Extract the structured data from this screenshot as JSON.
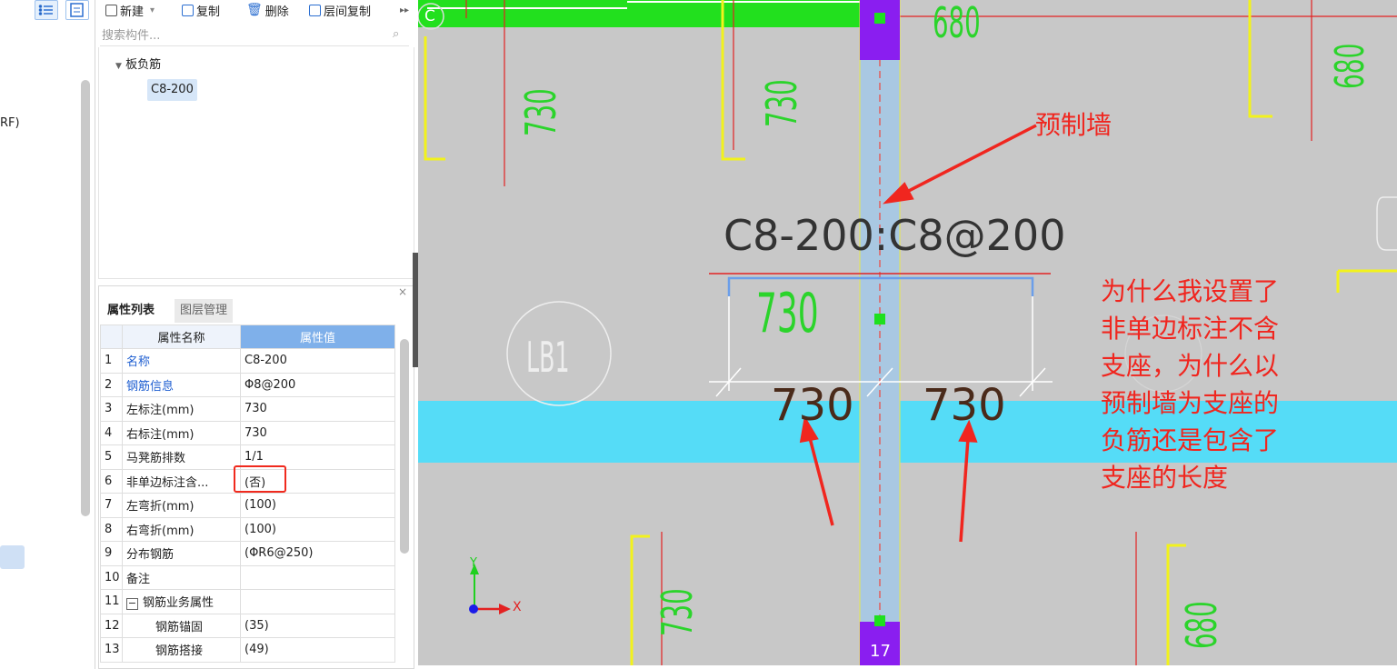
{
  "left_strip": {
    "partial_text": "RF)"
  },
  "toolbar": {
    "new_label": "新建",
    "copy_label": "复制",
    "delete_label": "删除",
    "floor_copy_label": "层间复制"
  },
  "search": {
    "placeholder": "搜索构件..."
  },
  "tree": {
    "category": "板负筋",
    "item": "C8-200"
  },
  "props": {
    "tabs": [
      "属性列表",
      "图层管理"
    ],
    "header": {
      "name": "属性名称",
      "value": "属性值"
    },
    "rows": [
      {
        "no": "1",
        "name": "名称",
        "value": "C8-200",
        "link": true
      },
      {
        "no": "2",
        "name": "钢筋信息",
        "value": "Φ8@200",
        "link": true
      },
      {
        "no": "3",
        "name": "左标注(mm)",
        "value": "730"
      },
      {
        "no": "4",
        "name": "右标注(mm)",
        "value": "730"
      },
      {
        "no": "5",
        "name": "马凳筋排数",
        "value": "1/1"
      },
      {
        "no": "6",
        "name": "非单边标注含...",
        "value": "(否)"
      },
      {
        "no": "7",
        "name": "左弯折(mm)",
        "value": "(100)"
      },
      {
        "no": "8",
        "name": "右弯折(mm)",
        "value": "(100)"
      },
      {
        "no": "9",
        "name": "分布钢筋",
        "value": "(ΦR6@250)"
      },
      {
        "no": "10",
        "name": "备注",
        "value": ""
      },
      {
        "no": "11",
        "name": "钢筋业务属性",
        "value": "",
        "group": true
      },
      {
        "no": "12",
        "name": "钢筋锚固",
        "value": "(35)",
        "child": true
      },
      {
        "no": "13",
        "name": "钢筋搭接",
        "value": "(49)",
        "child": true
      }
    ]
  },
  "canvas": {
    "axis_label": "C",
    "rebar_label": "C8-200:C8@200",
    "dim_top": "730",
    "dim_left": "730",
    "dim_right": "730",
    "slab_label": "LB1",
    "grid_number": "17",
    "top_dim_680": "680",
    "right_dim_680": "680",
    "bottom_right_680": "680",
    "small_730_a": "730",
    "small_730_b": "730",
    "small_730_bottom": "730",
    "annotation_wall": "预制墙",
    "annotation_question": [
      "为什么我设置了",
      "非单边标注不含",
      "支座，为什么以",
      "预制墙为支座的",
      "负筋还是包含了",
      "支座的长度"
    ],
    "axis_x": "X",
    "axis_y": "Y"
  },
  "colors": {
    "canvas_bg": "#c8c8c8",
    "beam_cyan": "#55dcf7",
    "beam_green": "#22e01e",
    "wall_blue": "#a9c8e2",
    "column_purple": "#8a1ef0",
    "annotation_red": "#f0261f"
  }
}
